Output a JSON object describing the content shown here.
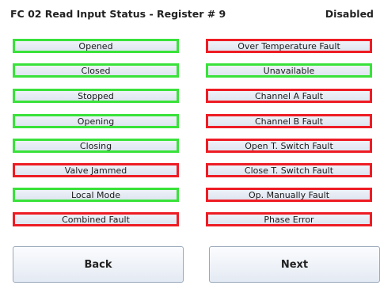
{
  "header": {
    "title": "FC 02 Read Input Status - Register # 9",
    "status": "Disabled"
  },
  "colors": {
    "active_border": "#39e23a",
    "fault_border": "#ee1c24"
  },
  "left_column": [
    {
      "label": "Opened",
      "state": "green"
    },
    {
      "label": "Closed",
      "state": "green"
    },
    {
      "label": "Stopped",
      "state": "green"
    },
    {
      "label": "Opening",
      "state": "green"
    },
    {
      "label": "Closing",
      "state": "green"
    },
    {
      "label": "Valve Jammed",
      "state": "red"
    },
    {
      "label": "Local Mode",
      "state": "green"
    },
    {
      "label": "Combined Fault",
      "state": "red"
    }
  ],
  "right_column": [
    {
      "label": "Over Temperature Fault",
      "state": "red"
    },
    {
      "label": "Unavailable",
      "state": "green"
    },
    {
      "label": "Channel A Fault",
      "state": "red"
    },
    {
      "label": "Channel B Fault",
      "state": "red"
    },
    {
      "label": "Open T. Switch Fault",
      "state": "red"
    },
    {
      "label": "Close T. Switch Fault",
      "state": "red"
    },
    {
      "label": "Op. Manually Fault",
      "state": "red"
    },
    {
      "label": "Phase Error",
      "state": "red"
    }
  ],
  "buttons": {
    "back": "Back",
    "next": "Next"
  }
}
